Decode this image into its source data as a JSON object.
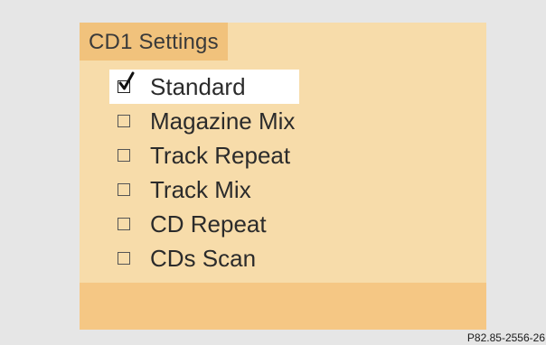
{
  "screen": {
    "title": "CD1 Settings",
    "menu_items": [
      {
        "label": "Standard",
        "checked": true,
        "selected": true
      },
      {
        "label": "Magazine Mix",
        "checked": false,
        "selected": false
      },
      {
        "label": "Track Repeat",
        "checked": false,
        "selected": false
      },
      {
        "label": "Track Mix",
        "checked": false,
        "selected": false
      },
      {
        "label": "CD Repeat",
        "checked": false,
        "selected": false
      },
      {
        "label": "CDs Scan",
        "checked": false,
        "selected": false
      }
    ]
  },
  "caption": "P82.85-2556-26",
  "colors": {
    "page_background": "#e6e6e6",
    "screen_background": "#f7dcaa",
    "title_tab_background": "#f1c27c",
    "bottom_bar_background": "#f5c784",
    "highlight_background": "#ffffff",
    "text": "#2b2b2b"
  },
  "icons": {
    "checked": "checkmark-icon",
    "unchecked": "empty-checkbox-icon"
  }
}
